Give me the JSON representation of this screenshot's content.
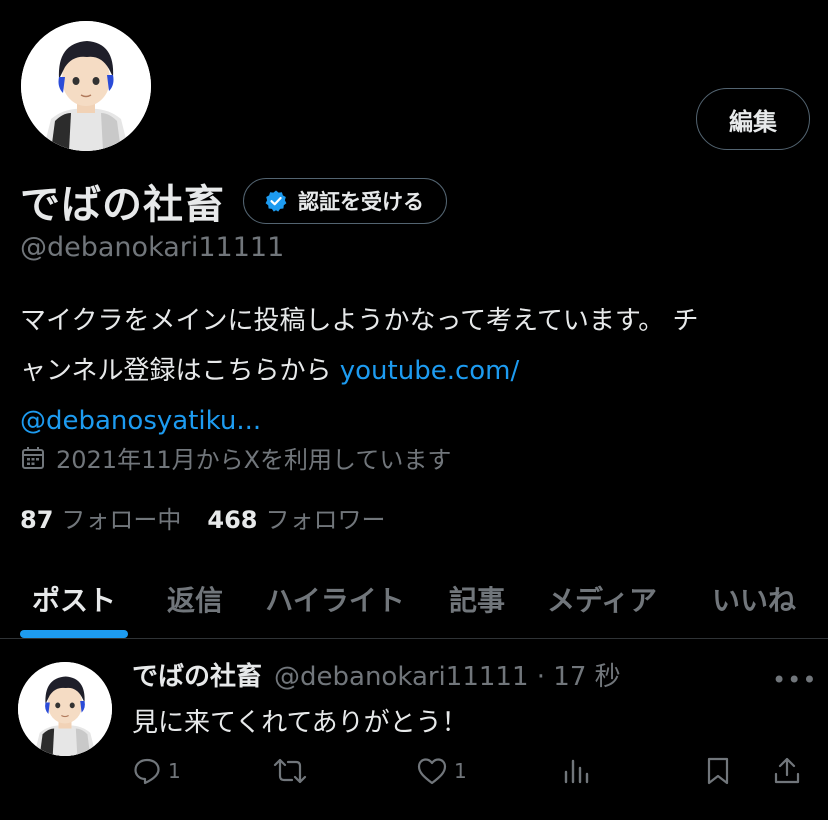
{
  "profile": {
    "edit_label": "編集",
    "display_name": "でばの社畜",
    "verify_label": "認証を受ける",
    "handle": "@debanokari11111",
    "bio_line1": "マイクラをメインに投稿しようかなって考えています。 チ",
    "bio_line2_text": "ャンネル登録はこちらから ",
    "bio_link_part1": "youtube.com/",
    "bio_link_part2": "@debanosyatiku...",
    "joined": "2021年11月からXを利用しています",
    "following_count": "87",
    "following_label": "フォロー中",
    "followers_count": "468",
    "followers_label": "フォロワー"
  },
  "tabs": [
    {
      "label": "ポスト",
      "active": true
    },
    {
      "label": "返信"
    },
    {
      "label": "ハイライト"
    },
    {
      "label": "記事"
    },
    {
      "label": "メディア"
    },
    {
      "label": "いいね"
    }
  ],
  "post": {
    "name": "でばの社畜",
    "handle_time": "@debanokari11111 · 17 秒",
    "more": "•••",
    "text": "見に来てくれてありがとう！",
    "reply_count": "1",
    "like_count": "1"
  },
  "colors": {
    "accent": "#1d9bf0",
    "muted": "#71767b",
    "text": "#e7e9ea",
    "background": "#000000"
  },
  "icons": [
    "verified-badge-icon",
    "calendar-icon",
    "reply-icon",
    "repost-icon",
    "like-icon",
    "views-icon",
    "bookmark-icon",
    "share-icon",
    "more-icon"
  ]
}
